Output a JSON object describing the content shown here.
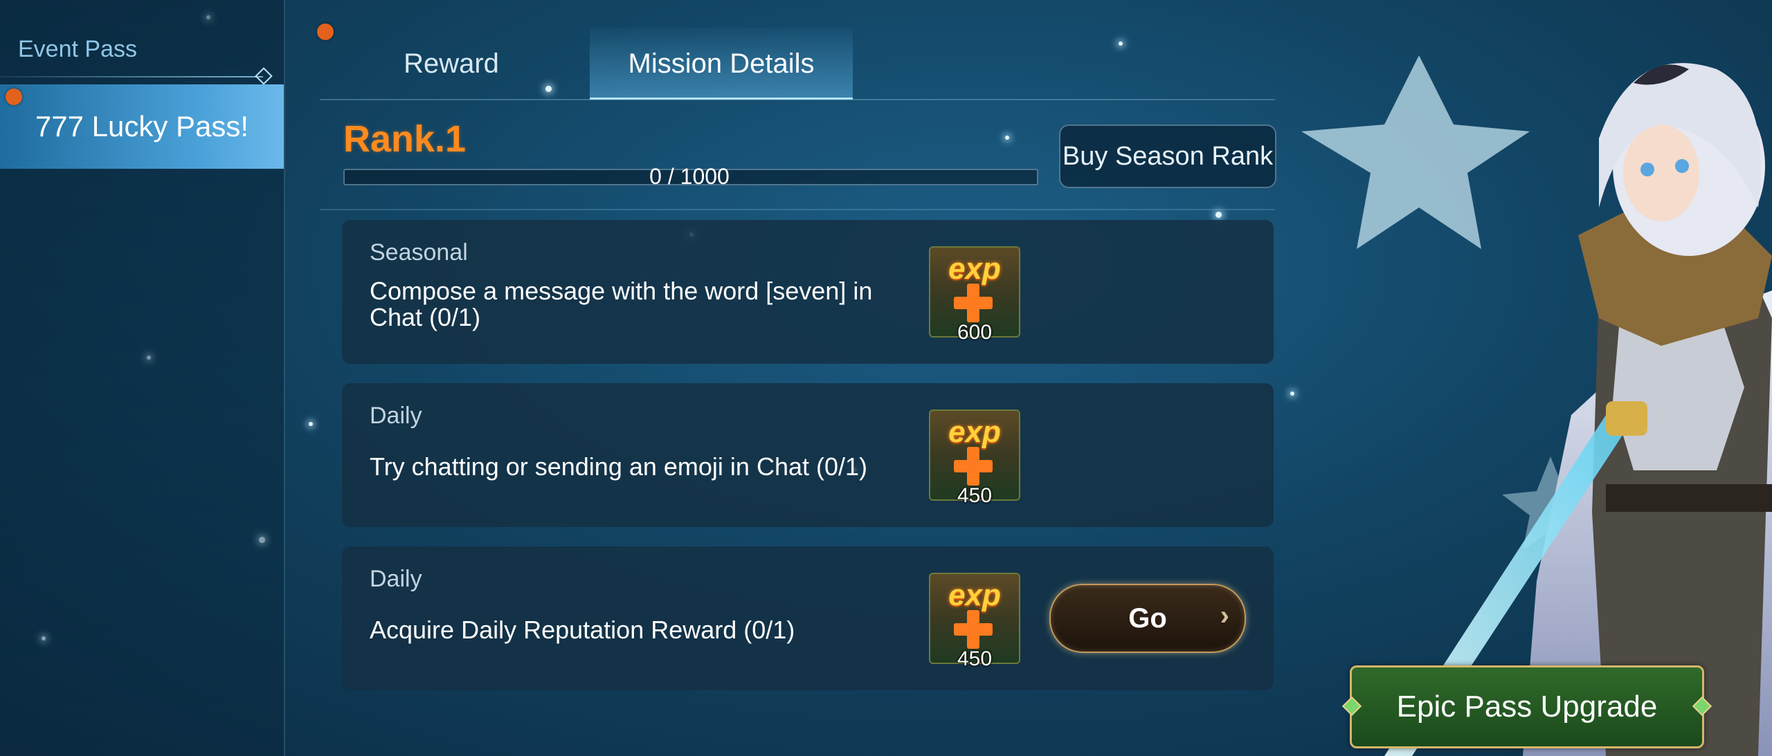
{
  "sidebar": {
    "header": "Event Pass",
    "items": [
      {
        "label": "777 Lucky Pass!",
        "selected": true
      }
    ]
  },
  "tabs": [
    {
      "label": "Reward",
      "active": false
    },
    {
      "label": "Mission Details",
      "active": true
    }
  ],
  "rank": {
    "label": "Rank.1",
    "progress_text": "0 / 1000",
    "progress_fraction": 0,
    "buy_label": "Buy Season Rank"
  },
  "missions": [
    {
      "category": "Seasonal",
      "description": "Compose a message with the word [seven] in Chat (0/1)",
      "reward_icon": "exp",
      "reward_amount": "600",
      "button": null
    },
    {
      "category": "Daily",
      "description": "Try chatting or sending an emoji in Chat (0/1)",
      "reward_icon": "exp",
      "reward_amount": "450",
      "button": null
    },
    {
      "category": "Daily",
      "description": "Acquire Daily Reputation Reward (0/1)",
      "reward_icon": "exp",
      "reward_amount": "450",
      "button": "Go"
    }
  ],
  "upgrade_button": "Epic Pass Upgrade",
  "colors": {
    "rank_orange": "#ff8a1e",
    "notification_dot": "#e2621d",
    "selected_item": "#4aa1d8",
    "upgrade_green": "#2f6a2a"
  },
  "icons": [
    "exp-plus-icon",
    "chevron-right-icon",
    "notification-dot"
  ]
}
